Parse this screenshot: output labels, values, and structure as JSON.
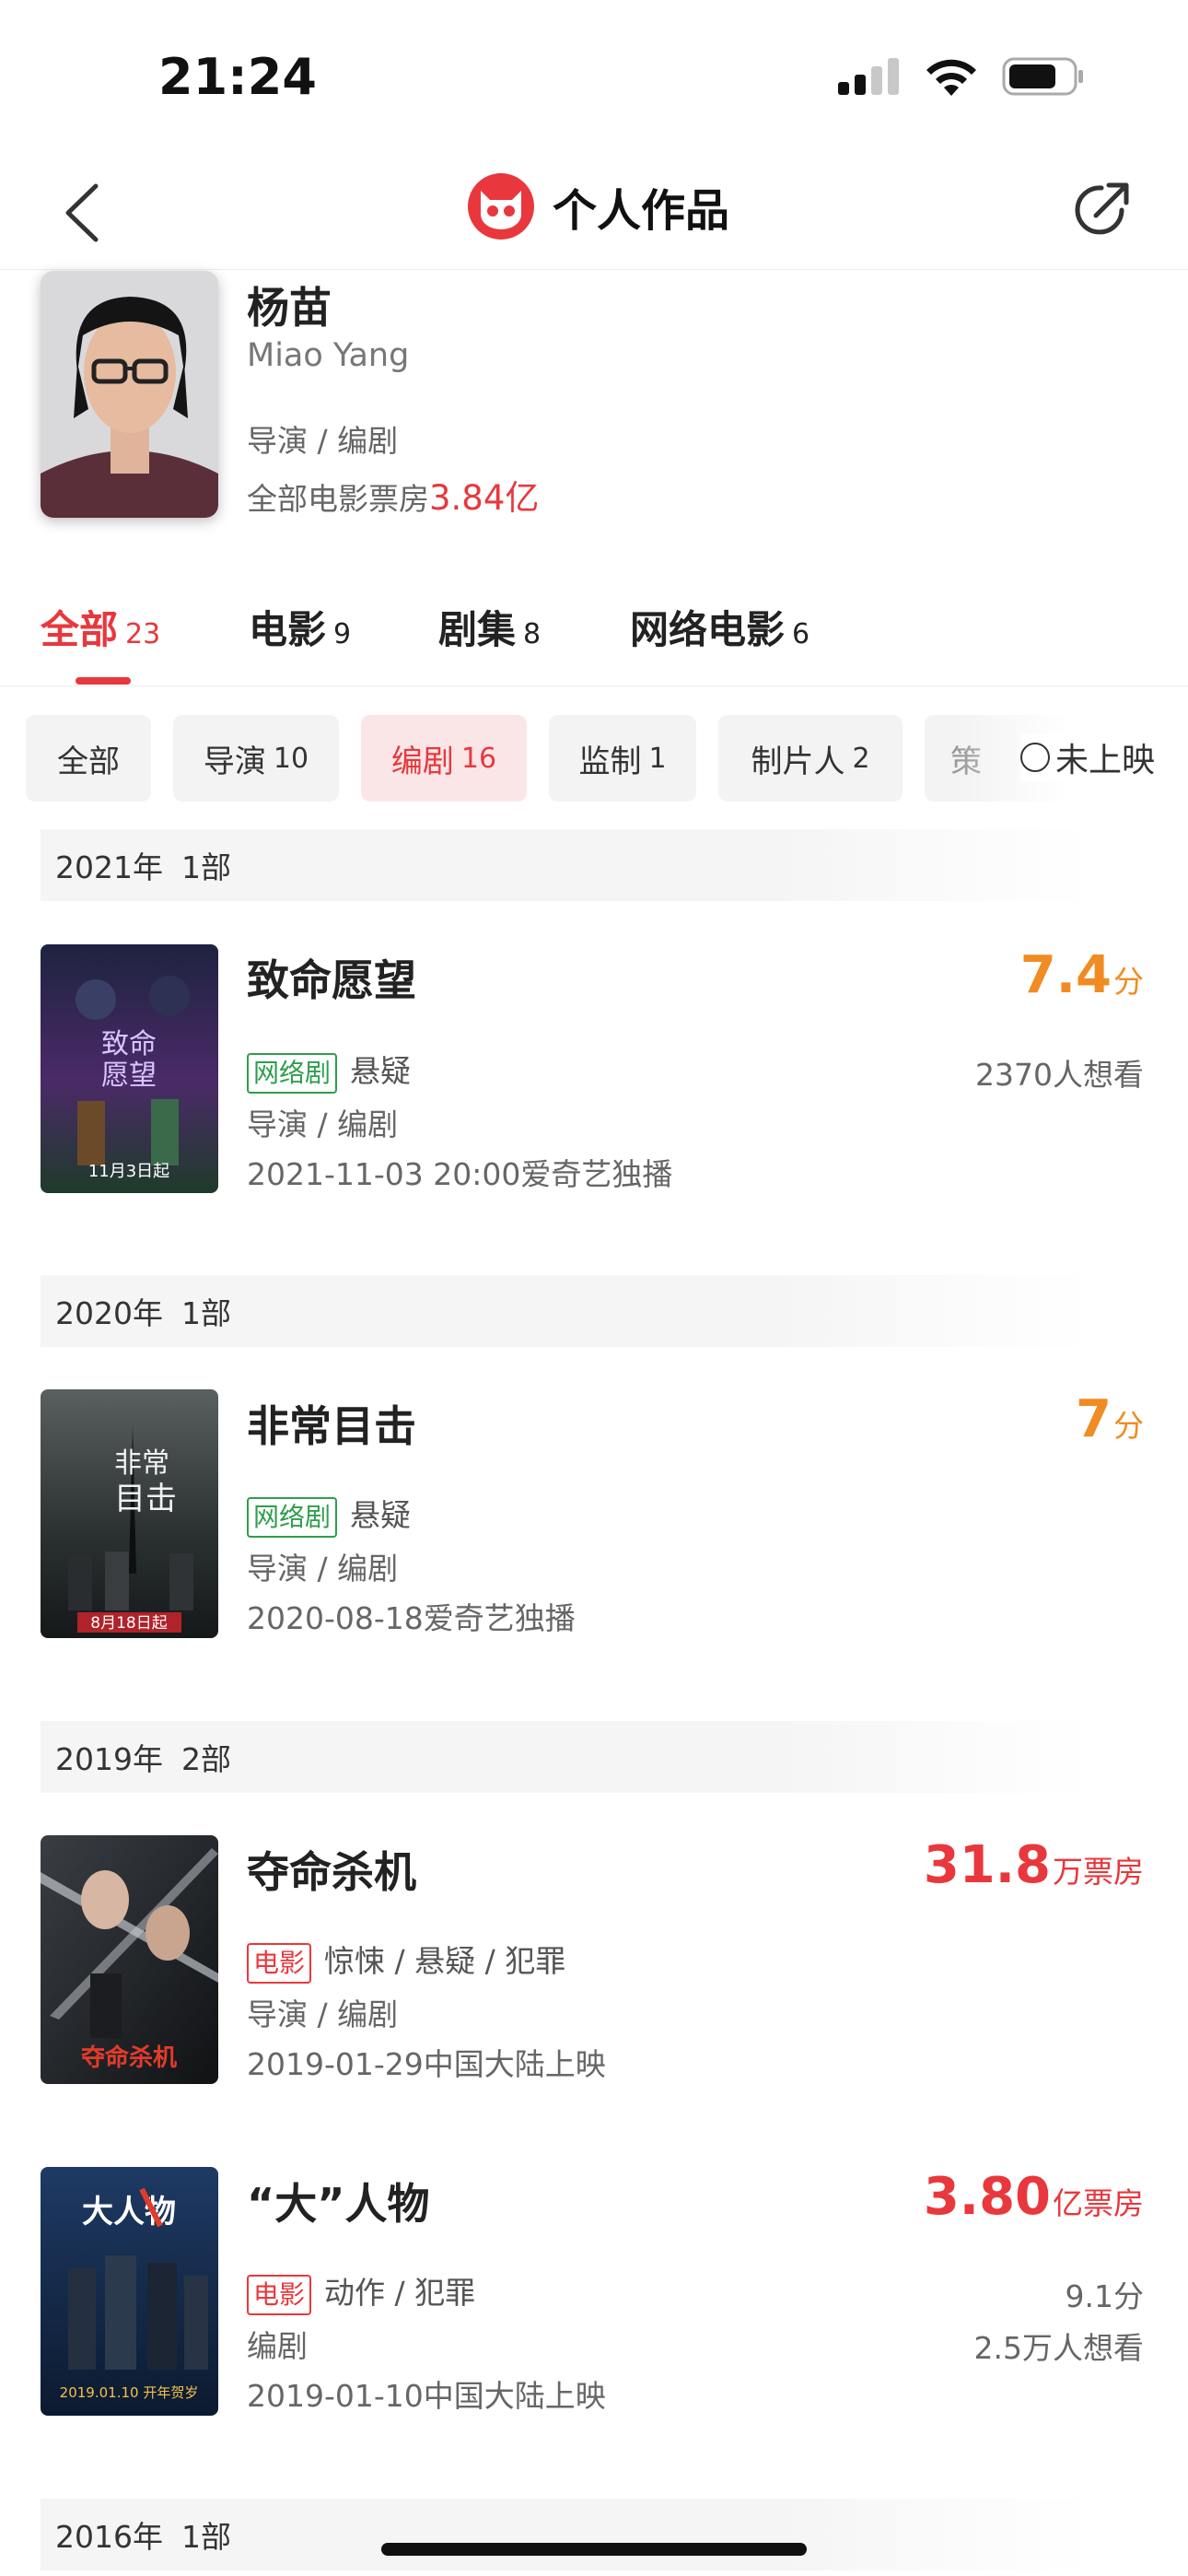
{
  "status_bar": {
    "time": "21:24"
  },
  "nav": {
    "title": "个人作品"
  },
  "profile": {
    "name_cn": "杨苗",
    "name_en": "Miao Yang",
    "roles": "导演 / 编剧",
    "box_office_label": "全部电影票房",
    "box_office_value": "3.84亿"
  },
  "tabs": [
    {
      "label": "全部",
      "count": "23",
      "active": true
    },
    {
      "label": "电影",
      "count": "9"
    },
    {
      "label": "剧集",
      "count": "8"
    },
    {
      "label": "网络电影",
      "count": "6"
    }
  ],
  "chips": [
    {
      "label": "全部",
      "count": ""
    },
    {
      "label": "导演",
      "count": "10"
    },
    {
      "label": "编剧",
      "count": "16",
      "selected": true
    },
    {
      "label": "监制",
      "count": "1"
    },
    {
      "label": "制片人",
      "count": "2"
    },
    {
      "label": "策",
      "count": ""
    }
  ],
  "unreleased_label": "未上映",
  "sections": [
    {
      "year": "2021年",
      "count": "1部"
    },
    {
      "year": "2020年",
      "count": "1部"
    },
    {
      "year": "2019年",
      "count": "2部"
    },
    {
      "year": "2016年",
      "count": "1部"
    }
  ],
  "movies": [
    {
      "title": "致命愿望",
      "tag": "网络剧",
      "genre": "悬疑",
      "roles": "导演 / 编剧",
      "release": "2021-11-03 20:00爱奇艺独播",
      "score": "7.4",
      "score_unit": "分",
      "want": "2370人想看",
      "poster_text": "致命愿望",
      "poster_date": "11月3日起"
    },
    {
      "title": "非常目击",
      "tag": "网络剧",
      "genre": "悬疑",
      "roles": "导演 / 编剧",
      "release": "2020-08-18爱奇艺独播",
      "score": "7",
      "score_unit": "分",
      "poster_text": "非常目击",
      "poster_date": "8月18日起"
    },
    {
      "title": "夺命杀机",
      "tag": "电影",
      "genre": "惊悚 / 悬疑 / 犯罪",
      "roles": "导演 / 编剧",
      "release": "2019-01-29中国大陆上映",
      "box_office": "31.8",
      "box_office_unit": "万票房",
      "poster_text": "夺命杀机"
    },
    {
      "title": "“大”人物",
      "tag": "电影",
      "genre": "动作 / 犯罪",
      "roles": "编剧",
      "release": "2019-01-10中国大陆上映",
      "box_office": "3.80",
      "box_office_unit": "亿票房",
      "rating": "9.1分",
      "want": "2.5万人想看",
      "poster_text": "大人物",
      "poster_date": "2019.01.10 开年贺岁"
    }
  ],
  "colors": {
    "accent": "#e8383d",
    "score": "#f08c23",
    "tag_green": "#2e9e4c"
  }
}
